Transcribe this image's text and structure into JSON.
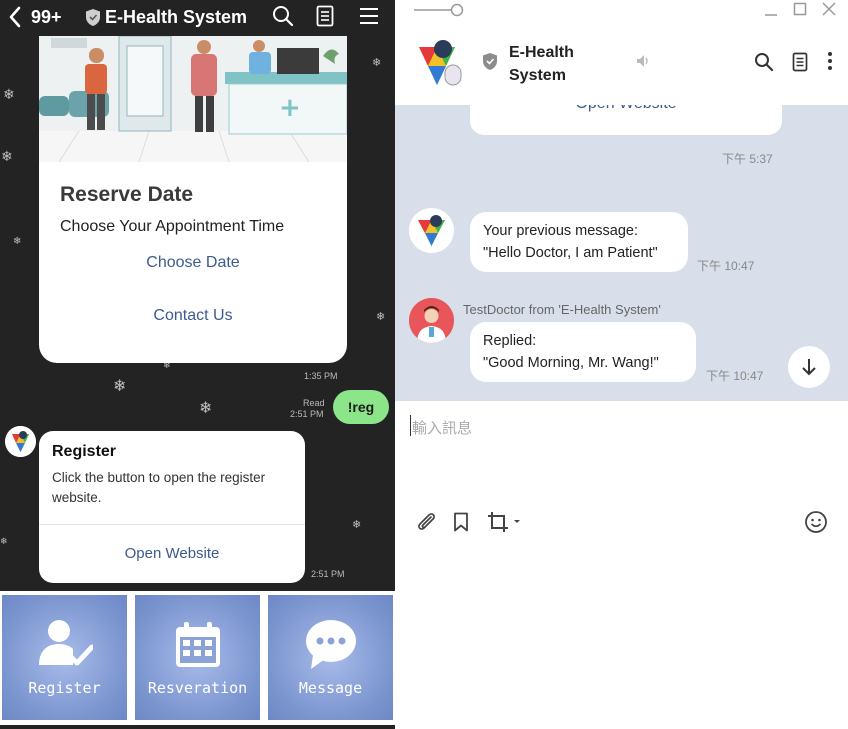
{
  "mobile": {
    "header": {
      "unread_count": "99+",
      "title": "E-Health System"
    },
    "reserve_card": {
      "title": "Reserve Date",
      "subtitle": "Choose Your Appointment Time",
      "link_choose": "Choose Date",
      "link_contact": "Contact Us",
      "time": "1:35 PM"
    },
    "user_message": {
      "text": "!reg",
      "read_label": "Read",
      "time": "2:51 PM"
    },
    "register_card": {
      "title": "Register",
      "description": "Click the button to open the register website.",
      "button": "Open Website",
      "time": "2:51 PM"
    },
    "rich_menu": [
      {
        "label": "Register",
        "icon": "user-check-icon"
      },
      {
        "label": "Resveration",
        "icon": "calendar-icon"
      },
      {
        "label": "Message",
        "icon": "chat-bubble-icon"
      }
    ]
  },
  "desktop": {
    "chat_name": "E-Health System",
    "partial_button": "Open Website",
    "messages": [
      {
        "time": "下午 5:37"
      },
      {
        "line1": "Your previous message:",
        "line2": "\"Hello Doctor, I am Patient\"",
        "time": "下午 10:47"
      },
      {
        "sender": "TestDoctor from 'E-Health System'",
        "line1": "Replied:",
        "line2": "\"Good Morning, Mr. Wang!\"",
        "time": "下午 10:47"
      }
    ],
    "input_placeholder": "輸入訊息"
  },
  "colors": {
    "mobile_bg": "#232323",
    "link_blue": "#3d5a8f",
    "sent_bubble": "#8de58a",
    "rich_menu_blue": "#7b95cf",
    "desktop_chat_bg": "#d8dfea"
  }
}
